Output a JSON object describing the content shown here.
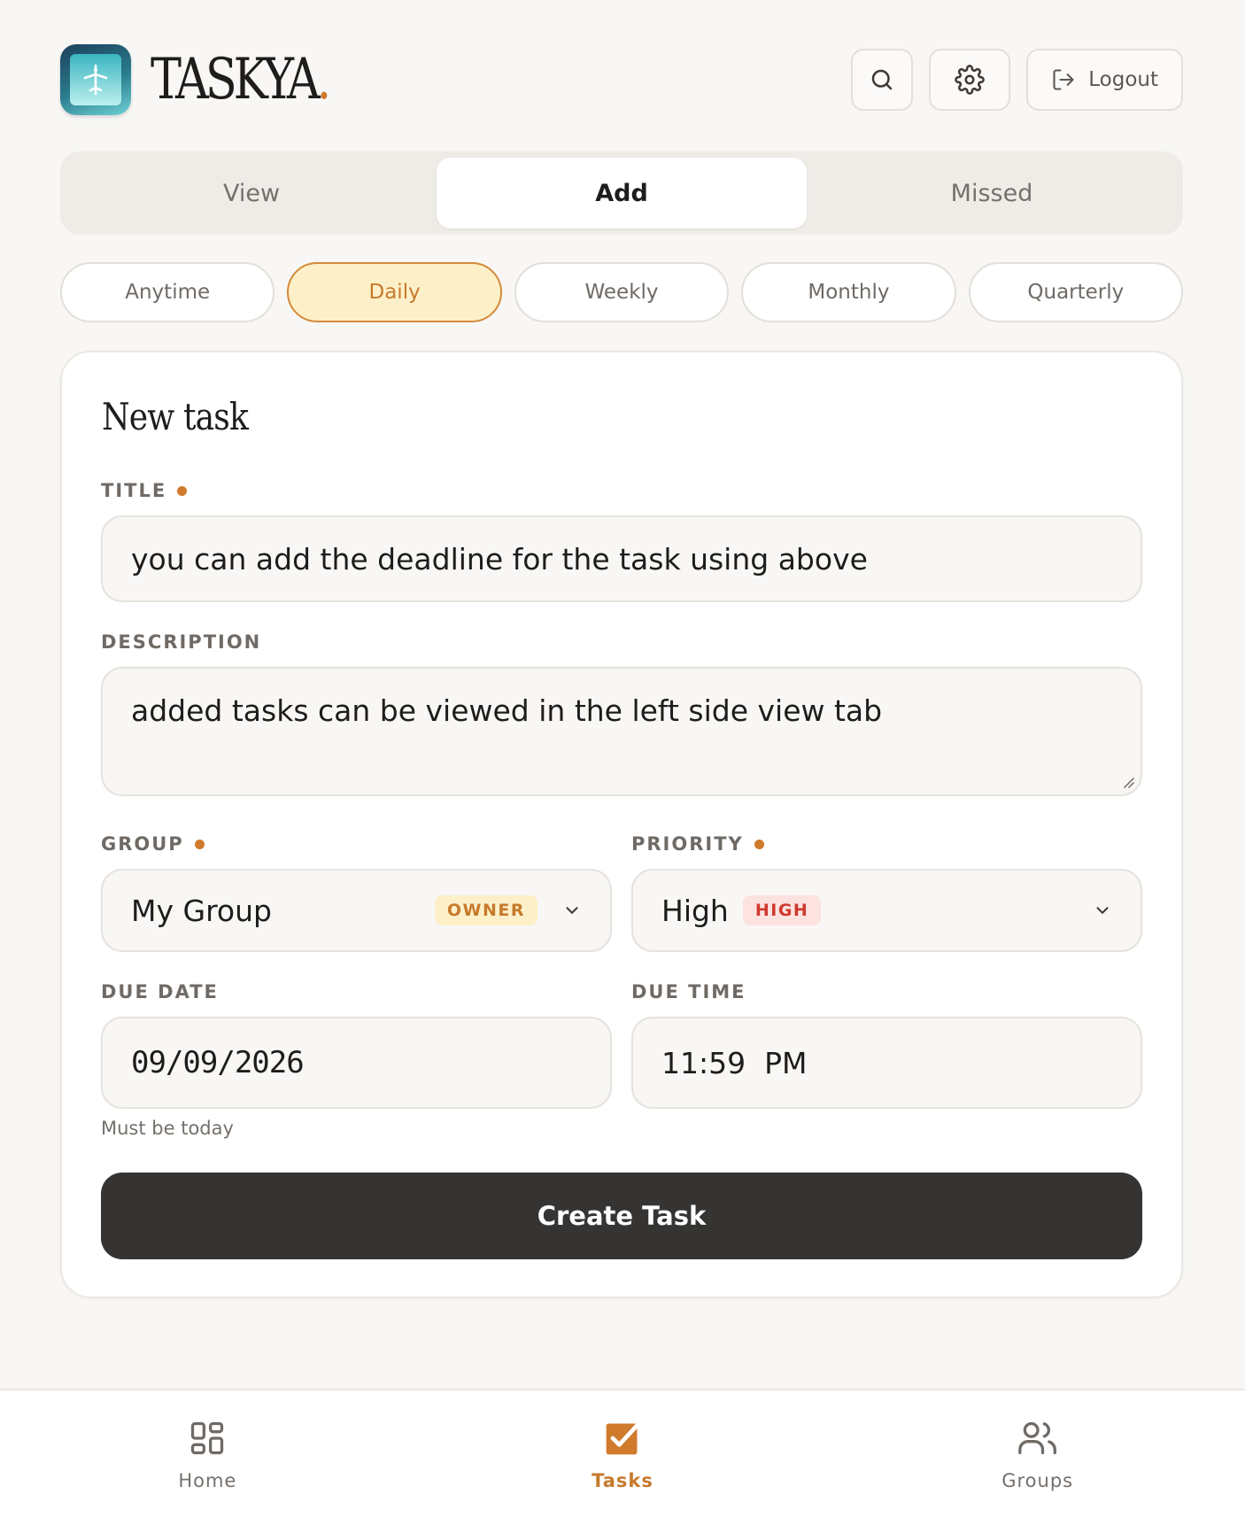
{
  "app": {
    "brand_name": "TASKYA",
    "brand_dot": "."
  },
  "header": {
    "search_icon": "search-icon",
    "settings_icon": "gear-icon",
    "logout_label": "Logout",
    "logout_icon": "logout-icon"
  },
  "tabs": [
    {
      "label": "View",
      "active": false
    },
    {
      "label": "Add",
      "active": true
    },
    {
      "label": "Missed",
      "active": false
    }
  ],
  "frequencies": [
    {
      "label": "Anytime",
      "active": false
    },
    {
      "label": "Daily",
      "active": true
    },
    {
      "label": "Weekly",
      "active": false
    },
    {
      "label": "Monthly",
      "active": false
    },
    {
      "label": "Quarterly",
      "active": false
    }
  ],
  "form": {
    "heading": "New task",
    "title_label": "TITLE",
    "title_value": "you can add the deadline for the task using above",
    "description_label": "DESCRIPTION",
    "description_value": "added tasks can be viewed in the left side view tab",
    "group_label": "GROUP",
    "group_value": "My Group",
    "group_badge": "OWNER",
    "priority_label": "PRIORITY",
    "priority_value": "High",
    "priority_badge": "HIGH",
    "due_date_label": "DUE DATE",
    "due_date_value": "09/09/2026",
    "due_date_hint": "Must be today",
    "due_time_label": "DUE TIME",
    "due_time_value": "11:59  PM",
    "submit_label": "Create Task"
  },
  "bottom_nav": [
    {
      "label": "Home",
      "icon": "grid-icon",
      "active": false
    },
    {
      "label": "Tasks",
      "icon": "checkbox-icon",
      "active": true
    },
    {
      "label": "Groups",
      "icon": "users-icon",
      "active": false
    }
  ],
  "colors": {
    "accent": "#d07a2c",
    "background": "#f8f7f5",
    "primary_button": "#363432",
    "active_pill_bg": "#fdf0c8",
    "high_badge_bg": "#fde3e0",
    "high_badge_text": "#d0392e"
  }
}
